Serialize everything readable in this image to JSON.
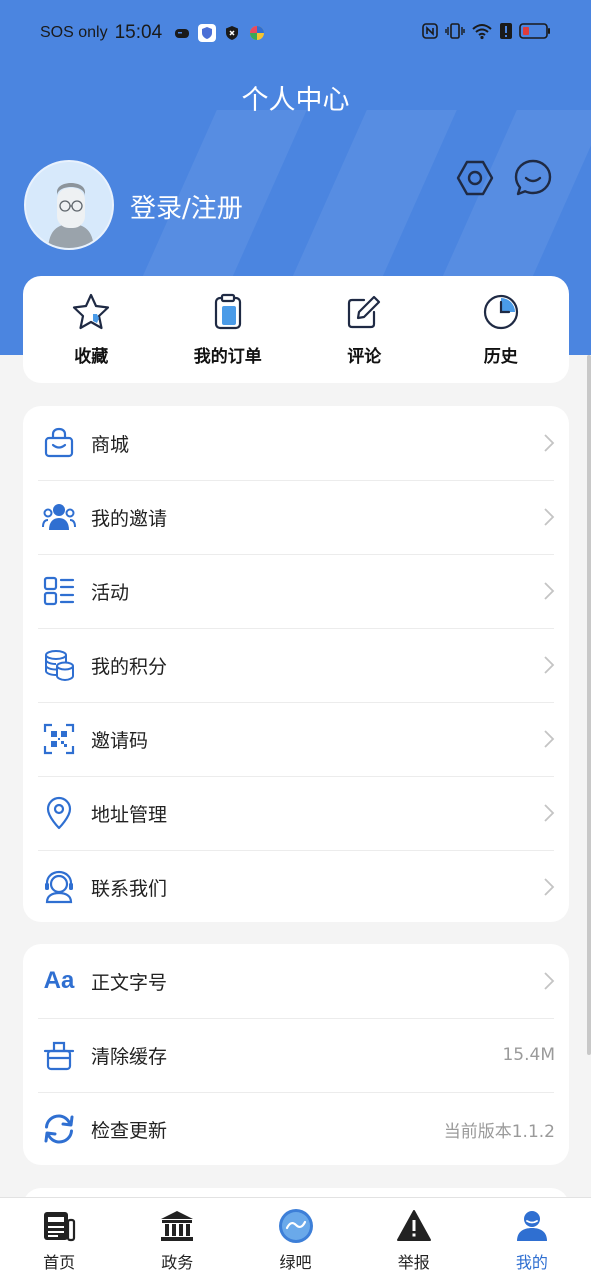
{
  "status_bar": {
    "carrier": "SOS only",
    "time": "15:04"
  },
  "header": {
    "title": "个人中心",
    "login_label": "登录/注册"
  },
  "quick_actions": [
    {
      "label": "收藏",
      "icon": "star-icon"
    },
    {
      "label": "我的订单",
      "icon": "clipboard-icon"
    },
    {
      "label": "评论",
      "icon": "edit-icon"
    },
    {
      "label": "历史",
      "icon": "clock-icon"
    }
  ],
  "menu_main": [
    {
      "label": "商城",
      "icon": "shopping-bag-icon"
    },
    {
      "label": "我的邀请",
      "icon": "users-icon"
    },
    {
      "label": "活动",
      "icon": "list-icon"
    },
    {
      "label": "我的积分",
      "icon": "coins-icon"
    },
    {
      "label": "邀请码",
      "icon": "qr-code-icon"
    },
    {
      "label": "地址管理",
      "icon": "location-pin-icon"
    },
    {
      "label": "联系我们",
      "icon": "headset-icon"
    }
  ],
  "menu_settings": [
    {
      "label": "正文字号",
      "icon": "font-size-icon",
      "value": ""
    },
    {
      "label": "清除缓存",
      "icon": "trash-icon",
      "value": "15.4M"
    },
    {
      "label": "检查更新",
      "icon": "refresh-icon",
      "value": "当前版本1.1.2"
    }
  ],
  "font_icon_text": "Aa",
  "tabbar": [
    {
      "label": "首页",
      "icon": "newspaper-icon"
    },
    {
      "label": "政务",
      "icon": "government-building-icon"
    },
    {
      "label": "绿吧",
      "icon": "green-bar-logo-icon"
    },
    {
      "label": "举报",
      "icon": "warning-icon"
    },
    {
      "label": "我的",
      "icon": "profile-icon",
      "active": true
    }
  ],
  "colors": {
    "primary": "#4b85e0",
    "icon_blue": "#2f6fd1",
    "active_tab": "#2f6fd1"
  }
}
